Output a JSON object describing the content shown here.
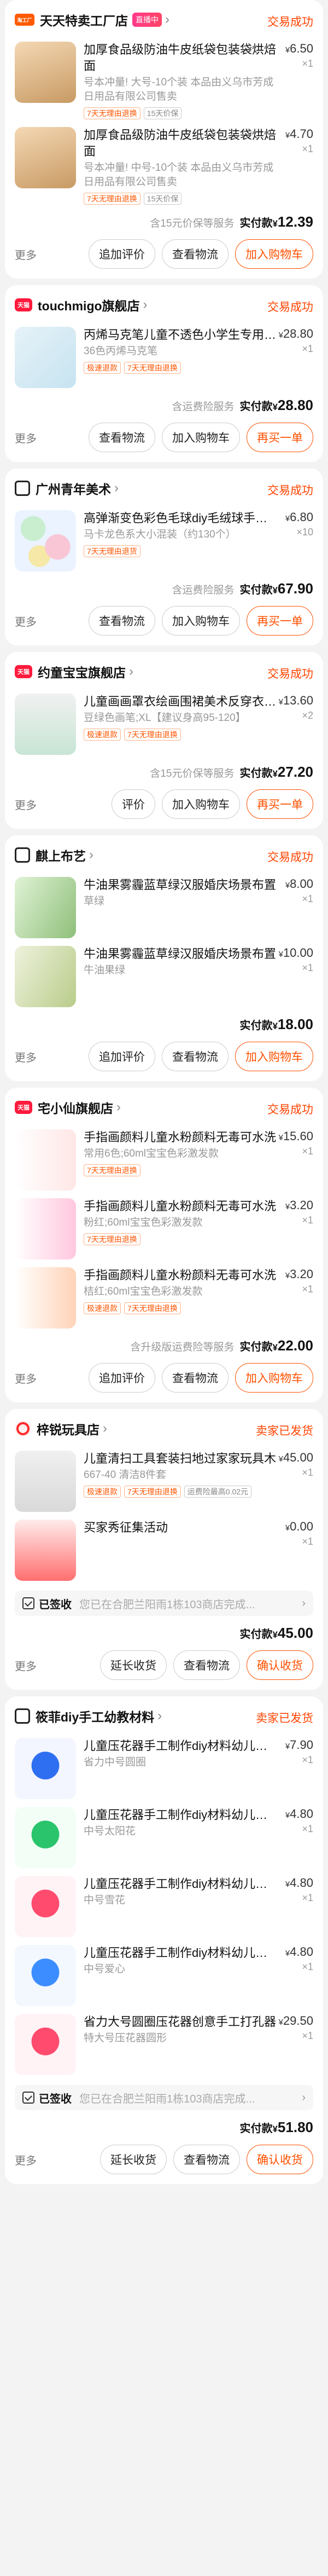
{
  "orders": [
    {
      "shop": "天天特卖工厂店",
      "shop_icon": "store-icon",
      "live": "直播中",
      "status": "交易成功",
      "items": [
        {
          "title": "加厚食品级防油牛皮纸袋包装袋烘焙面",
          "sku": "号本冲量! 大号-10个装 本品由义乌市芳成日用品有限公司售卖",
          "price": "6.50",
          "qty": "×1",
          "tags": [
            "7天无理由退换",
            "15天价保"
          ]
        },
        {
          "title": "加厚食品级防油牛皮纸袋包装袋烘焙面",
          "sku": "号本冲量! 中号-10个装 本品由义乌市芳成日用品有限公司售卖",
          "price": "4.70",
          "qty": "×1",
          "tags": [
            "7天无理由退换",
            "15天价保"
          ]
        }
      ],
      "note": "含15元价保等服务",
      "paid_label": "实付款",
      "paid": "12.39",
      "more": "更多",
      "buttons": [
        "追加评价",
        "查看物流",
        "加入购物车"
      ]
    },
    {
      "shop": "touchmigo旗舰店",
      "shop_icon": "tmall-icon",
      "status": "交易成功",
      "items": [
        {
          "title": "丙烯马克笔儿童不透色小学生专用画画",
          "sku": "36色丙烯马克笔",
          "price": "28.80",
          "qty": "×1",
          "tags": [
            "极速退款",
            "7天无理由退换"
          ]
        }
      ],
      "note": "含运费险服务",
      "paid_label": "实付款",
      "paid": "28.80",
      "more": "更多",
      "buttons": [
        "查看物流",
        "加入购物车",
        "再买一单"
      ]
    },
    {
      "shop": "广州青年美术",
      "shop_icon": "store-icon",
      "status": "交易成功",
      "items": [
        {
          "title": "高弹渐变色彩色毛球diy毛绒球手工材",
          "sku": "马卡龙色系大小混装（约130个）",
          "price": "6.80",
          "qty": "×10",
          "tags": [
            "7天无理由退货"
          ]
        }
      ],
      "note": "含运费险服务",
      "paid_label": "实付款",
      "paid": "67.90",
      "more": "更多",
      "buttons": [
        "查看物流",
        "加入购物车",
        "再买一单"
      ]
    },
    {
      "shop": "约童宝宝旗舰店",
      "shop_icon": "tmall-icon",
      "status": "交易成功",
      "items": [
        {
          "title": "儿童画画罩衣绘画围裙美术反穿衣幼儿",
          "sku": "豆绿色画笔;XL【建议身高95-120】",
          "price": "13.60",
          "qty": "×2",
          "tags": [
            "极速退款",
            "7天无理由退换"
          ]
        }
      ],
      "note": "含15元价保等服务",
      "paid_label": "实付款",
      "paid": "27.20",
      "more": "更多",
      "buttons": [
        "评价",
        "加入购物车",
        "再买一单"
      ]
    },
    {
      "shop": "麒上布艺",
      "shop_icon": "store-icon",
      "status": "交易成功",
      "items": [
        {
          "title": "牛油果雾霾蓝草绿汉服婚庆场景布置",
          "sku": "草绿",
          "price": "8.00",
          "qty": "×1",
          "tags": []
        },
        {
          "title": "牛油果雾霾蓝草绿汉服婚庆场景布置",
          "sku": "牛油果绿",
          "price": "10.00",
          "qty": "×1",
          "tags": []
        }
      ],
      "note": "",
      "paid_label": "实付款",
      "paid": "18.00",
      "more": "更多",
      "buttons": [
        "追加评价",
        "查看物流",
        "加入购物车"
      ]
    },
    {
      "shop": "宅小仙旗舰店",
      "shop_icon": "tmall-icon",
      "status": "交易成功",
      "items": [
        {
          "title": "手指画颜料儿童水粉颜料无毒可水洗",
          "sku": "常用6色;60ml宝宝色彩激发款",
          "price": "15.60",
          "qty": "×1",
          "tags": [
            "7天无理由退换"
          ]
        },
        {
          "title": "手指画颜料儿童水粉颜料无毒可水洗",
          "sku": "粉红;60ml宝宝色彩激发款",
          "price": "3.20",
          "qty": "×1",
          "tags": [
            "7天无理由退换"
          ]
        },
        {
          "title": "手指画颜料儿童水粉颜料无毒可水洗",
          "sku": "桔红;60ml宝宝色彩激发款",
          "price": "3.20",
          "qty": "×1",
          "tags": [
            "极速退款",
            "7天无理由退换"
          ]
        }
      ],
      "note": "含升级版运费险等服务",
      "paid_label": "实付款",
      "paid": "22.00",
      "more": "更多",
      "buttons": [
        "追加评价",
        "查看物流",
        "加入购物车"
      ]
    },
    {
      "shop": "梓锐玩具店",
      "shop_icon": "toy-icon",
      "status": "卖家已发货",
      "items": [
        {
          "title": "儿童清扫工具套装扫地过家家玩具木",
          "sku": "667-40 清洁8件套",
          "price": "45.00",
          "qty": "×1",
          "tags": [
            "极速退款",
            "7天无理由退换",
            "运费险最高0.02元"
          ]
        },
        {
          "title": "买家秀征集活动",
          "sku": "",
          "price": "0.00",
          "qty": "×1",
          "tags": []
        }
      ],
      "signed_label": "已签收",
      "signed_text": "您已在合肥兰阳雨1栋103商店完成...",
      "note": "",
      "paid_label": "实付款",
      "paid": "45.00",
      "more": "更多",
      "buttons": [
        "延长收货",
        "查看物流",
        "确认收货"
      ]
    },
    {
      "shop": "筱菲diy手工幼教材料",
      "shop_icon": "store-icon",
      "status": "卖家已发货",
      "items": [
        {
          "title": "儿童压花器手工制作diy材料幼儿园小",
          "sku": "省力中号圆圈",
          "price": "7.90",
          "qty": "×1",
          "tags": []
        },
        {
          "title": "儿童压花器手工制作diy材料幼儿园小",
          "sku": "中号太阳花",
          "price": "4.80",
          "qty": "×1",
          "tags": []
        },
        {
          "title": "儿童压花器手工制作diy材料幼儿园小",
          "sku": "中号雪花",
          "price": "4.80",
          "qty": "×1",
          "tags": []
        },
        {
          "title": "儿童压花器手工制作diy材料幼儿园小",
          "sku": "中号爱心",
          "price": "4.80",
          "qty": "×1",
          "tags": []
        },
        {
          "title": "省力大号圆圈压花器创意手工打孔器",
          "sku": "特大号压花器圆形",
          "price": "29.50",
          "qty": "×1",
          "tags": []
        }
      ],
      "signed_label": "已签收",
      "signed_text": "您已在合肥兰阳雨1栋103商店完成...",
      "note": "",
      "paid_label": "实付款",
      "paid": "51.80",
      "more": "更多",
      "buttons": [
        "延长收货",
        "查看物流",
        "确认收货"
      ]
    }
  ],
  "currency": "¥"
}
